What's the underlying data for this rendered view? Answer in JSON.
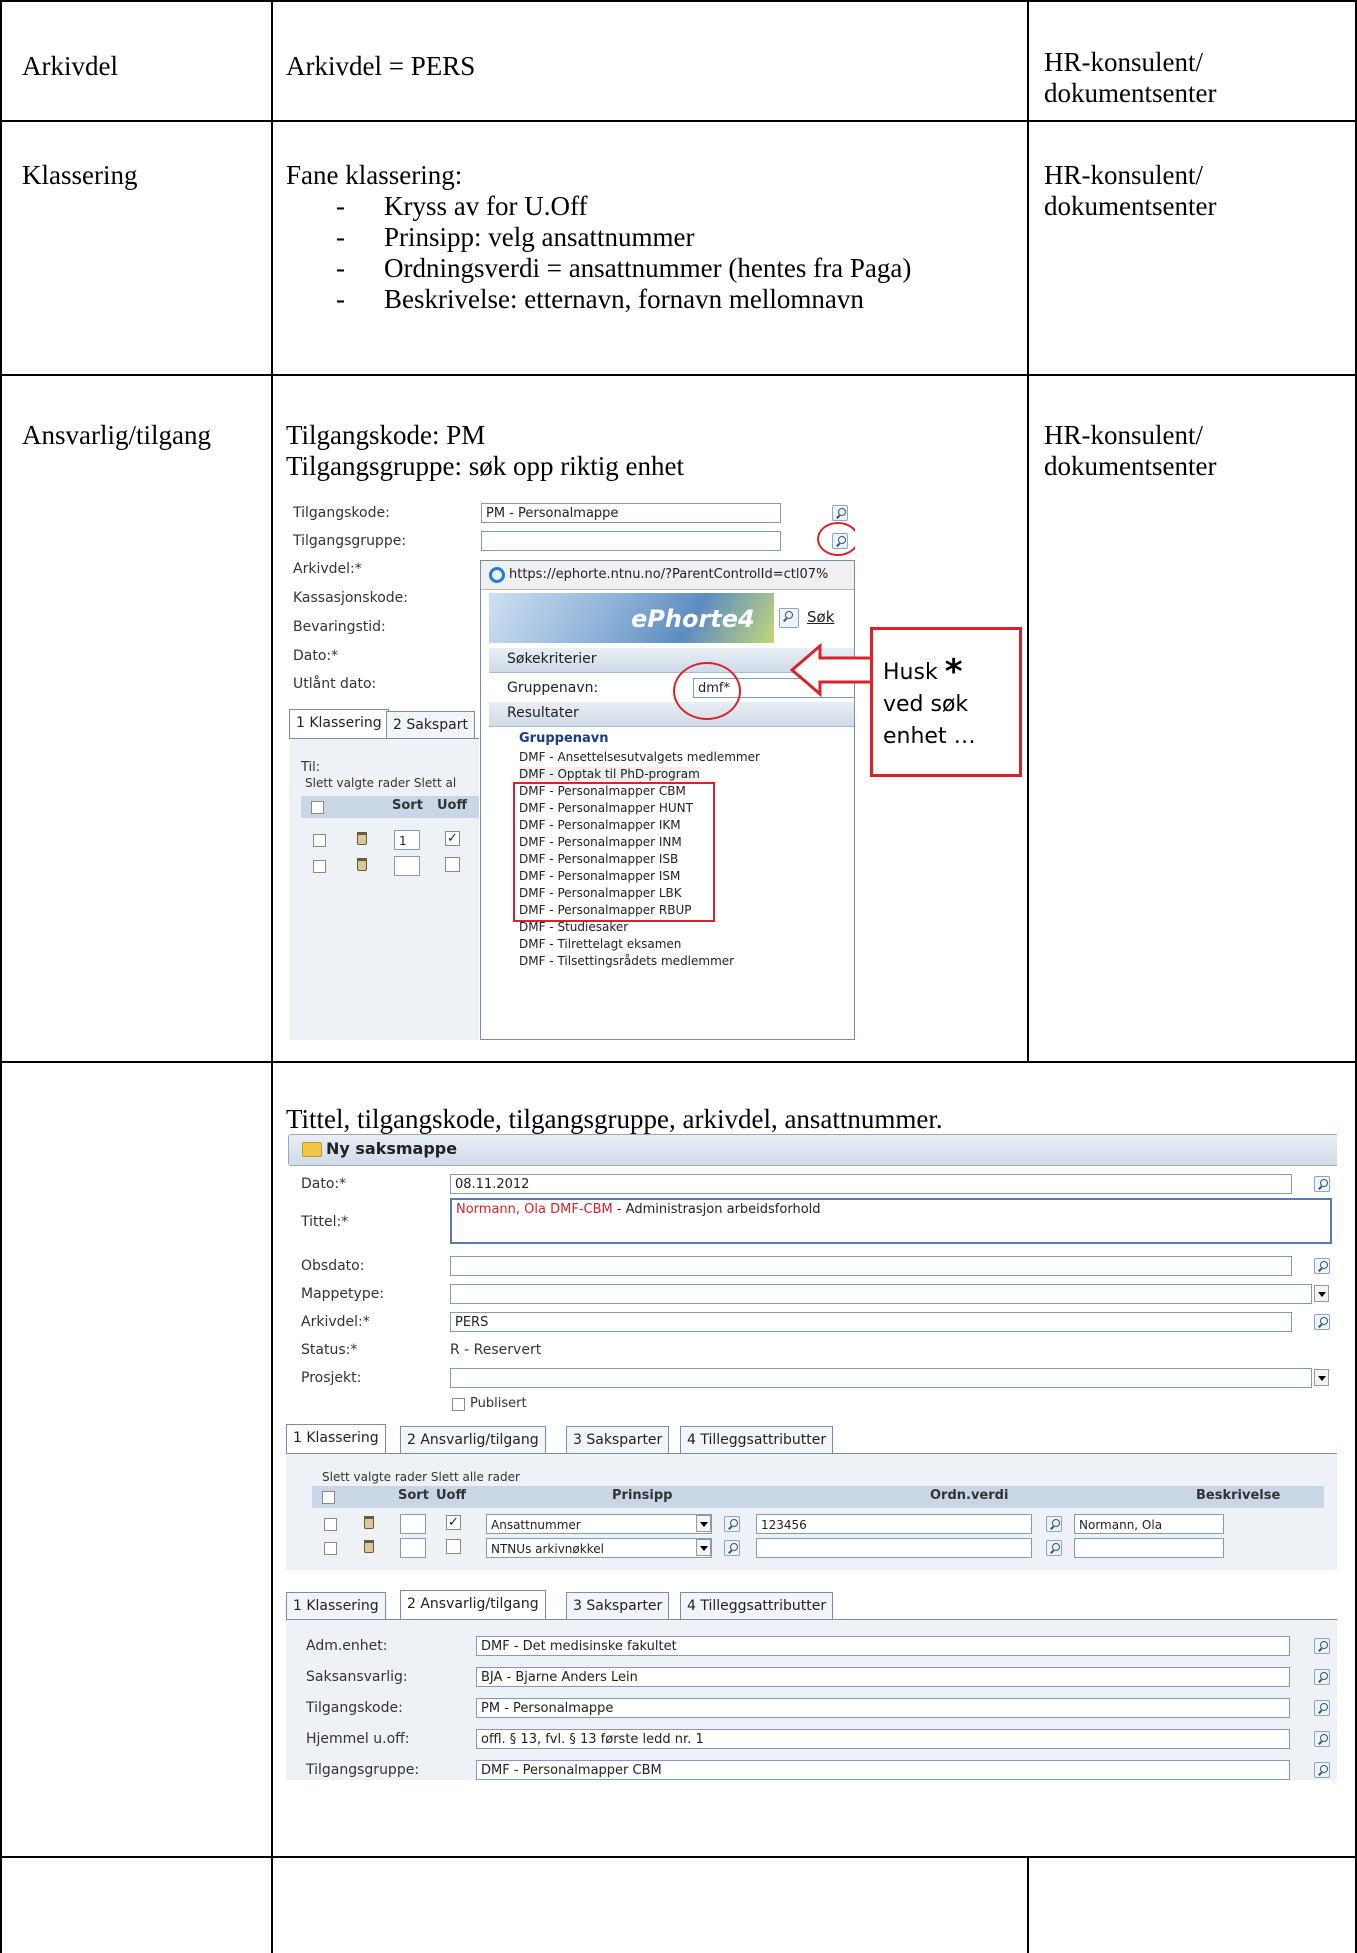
{
  "rows": [
    {
      "field": "Arkivdel",
      "content": "Arkivdel = PERS",
      "role": "HR-konsulent/",
      "role2": "dokumentsenter"
    },
    {
      "field": "Klassering",
      "content_title": "Fane klassering:",
      "bullets": [
        "Kryss av for U.Off",
        "Prinsipp: velg ansattnummer",
        "Ordningsverdi = ansattnummer (hentes fra Paga)",
        "Beskrivelse: etternavn, fornavn mellomnavn"
      ],
      "role": "HR-konsulent/",
      "role2": "dokumentsenter"
    },
    {
      "field": "Ansvarlig/tilgang",
      "content_line1": "Tilgangskode: PM",
      "content_line2": "Tilgangsgruppe: søk opp riktig enhet",
      "role": "HR-konsulent/",
      "role2": "dokumentsenter"
    },
    {
      "field": "",
      "content_title": "Tittel, tilgangskode, tilgangsgruppe, arkivdel, ansattnummer."
    }
  ],
  "shot1": {
    "labels": [
      "Tilgangskode:",
      "Tilgangsgruppe:",
      "Arkivdel:*",
      "Kassasjonskode:",
      "Bevaringstid:",
      "Dato:*",
      "Utlånt dato:"
    ],
    "tilgangskode_value": "PM - Personalmappe",
    "tabs": [
      "1 Klassering",
      "2 Sakspart"
    ],
    "til_label": "Til:",
    "slett_text": "Slett valgte rader Slett al",
    "col_sort": "Sort",
    "col_uoff": "Uoff",
    "row1_sort": "1",
    "popup": {
      "url": "https://ephorte.ntnu.no/?ParentControlId=ctl07%",
      "brand": "ePhorte4",
      "sok": "Søk",
      "section_criteria": "Søkekriterier",
      "gruppenavn_label": "Gruppenavn:",
      "search_value": "dmf*",
      "section_results": "Resultater",
      "results_header": "Gruppenavn",
      "results": [
        "DMF - Ansettelsesutvalgets medlemmer",
        "DMF - Opptak til PhD-program",
        "DMF - Personalmapper CBM",
        "DMF - Personalmapper HUNT",
        "DMF - Personalmapper IKM",
        "DMF - Personalmapper INM",
        "DMF - Personalmapper ISB",
        "DMF - Personalmapper ISM",
        "DMF - Personalmapper LBK",
        "DMF - Personalmapper RBUP",
        "DMF - Studiesaker",
        "DMF - Tilrettelagt eksamen",
        "DMF - Tilsettingsrådets medlemmer"
      ]
    },
    "callout": {
      "line1": "Husk",
      "star": "*",
      "line2": "ved søk",
      "line3": "enhet …"
    }
  },
  "shot2": {
    "title": "Ny saksmappe",
    "fields": {
      "dato_label": "Dato:*",
      "dato_value": "08.11.2012",
      "tittel_label": "Tittel:*",
      "tittel_red": "Normann, Ola DMF-CBM",
      "tittel_rest": " - Administrasjon arbeidsforhold",
      "obsdato_label": "Obsdato:",
      "mappetype_label": "Mappetype:",
      "arkivdel_label": "Arkivdel:*",
      "arkivdel_value": "PERS",
      "status_label": "Status:*",
      "status_value": "R - Reservert",
      "prosjekt_label": "Prosjekt:",
      "publisert_label": "Publisert"
    },
    "tabs": [
      "1 Klassering",
      "2 Ansvarlig/tilgang",
      "3 Saksparter",
      "4 Tilleggsattributter"
    ],
    "slett_text": "Slett valgte rader Slett alle rader",
    "cols": {
      "sort": "Sort",
      "uoff": "Uoff",
      "prinsipp": "Prinsipp",
      "ordnverdi": "Ordn.verdi",
      "beskrivelse": "Beskrivelse"
    },
    "klass_rows": [
      {
        "prinsipp": "Ansattnummer",
        "ordn": "123456",
        "beskr": "Normann, Ola"
      },
      {
        "prinsipp": "NTNUs arkivnøkkel",
        "ordn": "",
        "beskr": ""
      }
    ],
    "tabs2": [
      "1 Klassering",
      "2 Ansvarlig/tilgang",
      "3 Saksparter",
      "4 Tilleggsattributter"
    ],
    "ansvar": [
      {
        "label": "Adm.enhet:",
        "value": "DMF - Det medisinske fakultet"
      },
      {
        "label": "Saksansvarlig:",
        "value": "BJA - Bjarne Anders Lein"
      },
      {
        "label": "Tilgangskode:",
        "value": "PM - Personalmappe"
      },
      {
        "label": "Hjemmel u.off:",
        "value": "offl. § 13, fvl. § 13 første ledd nr. 1"
      },
      {
        "label": "Tilgangsgruppe:",
        "value": "DMF - Personalmapper CBM"
      }
    ]
  }
}
